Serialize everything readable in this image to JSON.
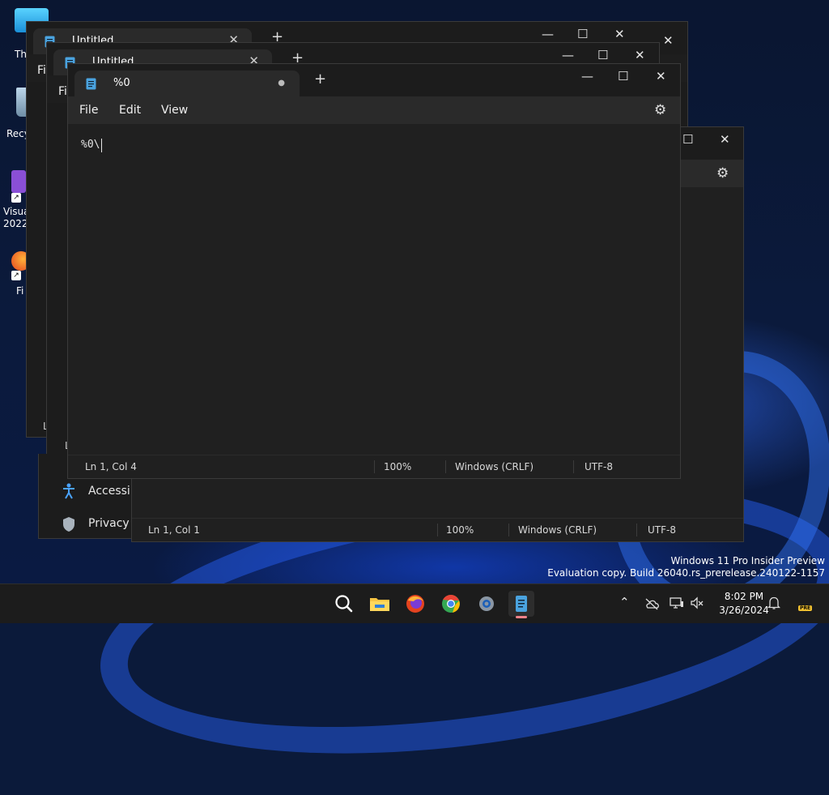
{
  "desktop": {
    "icons": [
      {
        "label": "Th"
      },
      {
        "label": "Recy"
      },
      {
        "label": "Visua\n2022"
      },
      {
        "label": "Fi"
      }
    ],
    "watermark": {
      "line1": "Windows 11 Pro Insider Preview",
      "line2": "Evaluation copy. Build 26040.rs_prerelease.240122-1157"
    }
  },
  "back_window_1": {
    "tab_label": "Untitled",
    "menu_file": "Fi",
    "status_ln": "L"
  },
  "back_window_2": {
    "tab_label": "Untitled",
    "menu_file": "Fi",
    "status_ln": "L"
  },
  "settings_window": {
    "items": [
      {
        "label": "Accessib"
      },
      {
        "label": "Privacy &"
      }
    ]
  },
  "notepad_back": {
    "status": {
      "position": "Ln 1, Col 1",
      "zoom": "100%",
      "line_ending": "Windows (CRLF)",
      "encoding": "UTF-8"
    }
  },
  "notepad_front": {
    "tab_label": "%0",
    "menu": {
      "file": "File",
      "edit": "Edit",
      "view": "View"
    },
    "content": "%0\\",
    "status": {
      "position": "Ln 1, Col 4",
      "zoom": "100%",
      "line_ending": "Windows (CRLF)",
      "encoding": "UTF-8"
    }
  },
  "taskbar": {
    "clock_time": "8:02 PM",
    "clock_date": "3/26/2024",
    "pre_badge": "PRE"
  },
  "glyphs": {
    "minimize": "—",
    "maximize": "☐",
    "close": "✕",
    "plus": "+",
    "dot": "●",
    "gear": "⚙",
    "caret_up": "⌃",
    "bell": "🔔",
    "shortcut": "↗"
  }
}
